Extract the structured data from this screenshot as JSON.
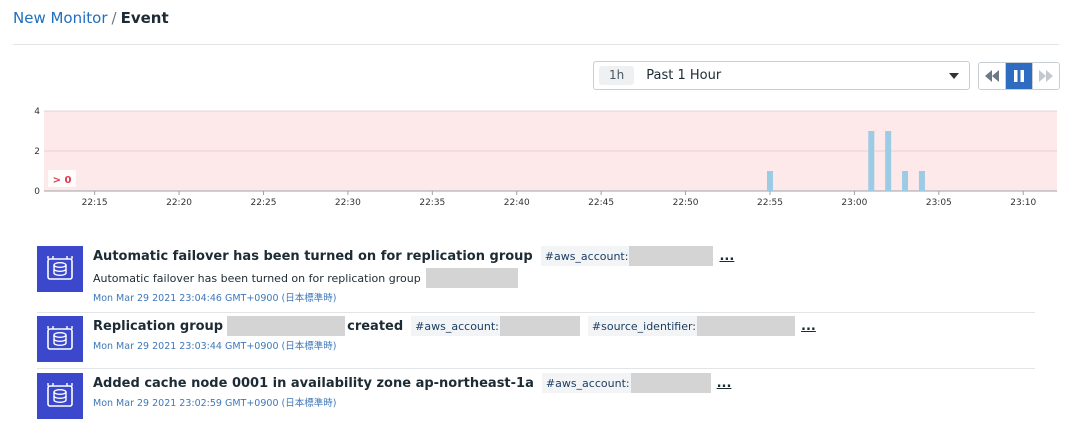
{
  "breadcrumb": {
    "parent": "New Monitor",
    "separator": "/",
    "current": "Event"
  },
  "time_selector": {
    "badge": "1h",
    "label": "Past 1 Hour"
  },
  "playback": {
    "active": "pause"
  },
  "chart_data": {
    "type": "bar",
    "x": [
      "22:55",
      "23:01",
      "23:02",
      "23:03",
      "23:04"
    ],
    "values": [
      1,
      3,
      3,
      1,
      1
    ],
    "x_ticks": [
      "22:15",
      "22:20",
      "22:25",
      "22:30",
      "22:35",
      "22:40",
      "22:45",
      "22:50",
      "22:55",
      "23:00",
      "23:05",
      "23:10"
    ],
    "y_ticks": [
      "0",
      "2",
      "4"
    ],
    "ylim": [
      0,
      4
    ],
    "threshold_label": "> 0",
    "colors": {
      "bar": "#9ccbe6",
      "threshold_band": "#fde9ea",
      "threshold_line": "#f0a0a8",
      "threshold_text": "#e0364d"
    },
    "grid": true
  },
  "events": [
    {
      "title": "Automatic failover has been turned on for replication group",
      "tags": [
        {
          "label": "#aws_account:"
        }
      ],
      "more": "...",
      "text": "Automatic failover has been turned on for replication group",
      "time": "Mon Mar 29 2021 23:04:46 GMT+0900 (日本標準時)"
    },
    {
      "title": "Replication group",
      "title_suffix": "created",
      "tags": [
        {
          "label": "#aws_account:"
        },
        {
          "label": "#source_identifier:"
        }
      ],
      "more": "...",
      "time": "Mon Mar 29 2021 23:03:44 GMT+0900 (日本標準時)"
    },
    {
      "title": "Added cache node 0001 in availability zone ap-northeast-1a",
      "tags": [
        {
          "label": "#aws_account:"
        }
      ],
      "more": "...",
      "time": "Mon Mar 29 2021 23:02:59 GMT+0900 (日本標準時)"
    }
  ]
}
